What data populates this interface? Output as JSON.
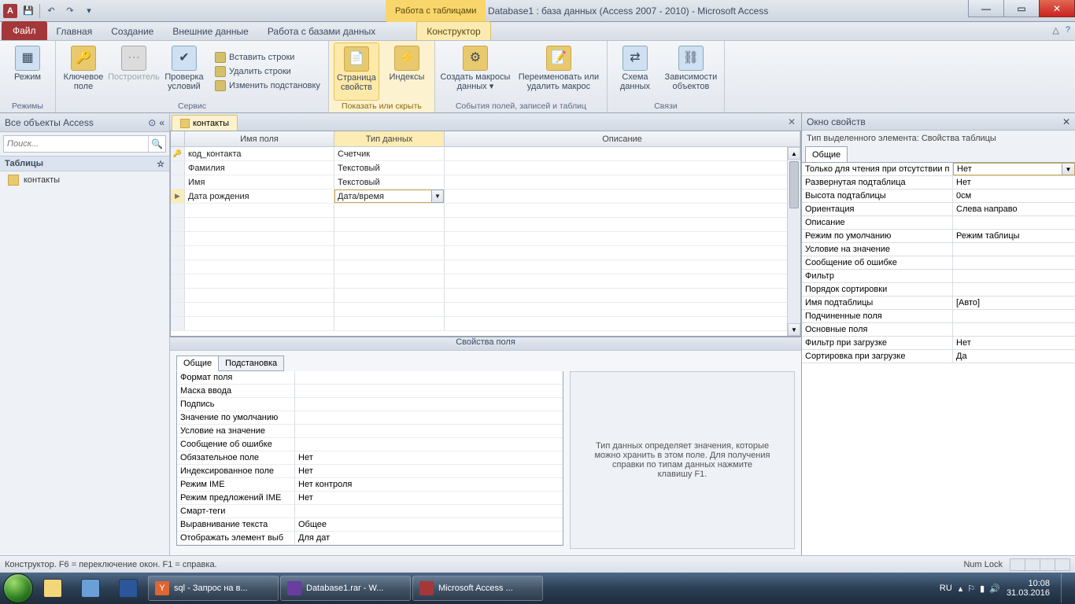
{
  "titlebar": {
    "context_tab": "Работа с таблицами",
    "title": "Database1 : база данных (Access 2007 - 2010)  -  Microsoft Access"
  },
  "ribbon_tabs": {
    "file": "Файл",
    "home": "Главная",
    "create": "Создание",
    "external": "Внешние данные",
    "dbtools": "Работа с базами данных",
    "design": "Конструктор"
  },
  "ribbon": {
    "g_views": {
      "label": "Режимы",
      "view": "Режим"
    },
    "g_tools": {
      "label": "Сервис",
      "primary_key": "Ключевое поле",
      "builder": "Построитель",
      "validation": "Проверка условий",
      "insert_rows": "Вставить строки",
      "delete_rows": "Удалить строки",
      "modify_lookup": "Изменить подстановку"
    },
    "g_showhide": {
      "label": "Показать или скрыть",
      "prop_sheet": "Страница свойств",
      "indexes": "Индексы"
    },
    "g_events": {
      "label": "События полей, записей и таблиц",
      "create_macros": "Создать макросы данных ▾",
      "rename_delete": "Переименовать или удалить макрос"
    },
    "g_rel": {
      "label": "Связи",
      "relationships": "Схема данных",
      "dependencies": "Зависимости объектов"
    }
  },
  "nav": {
    "header": "Все объекты Access",
    "search_placeholder": "Поиск...",
    "group_tables": "Таблицы",
    "item_contacts": "контакты"
  },
  "doc": {
    "tab": "контакты"
  },
  "grid": {
    "headers": {
      "name": "Имя поля",
      "type": "Тип данных",
      "desc": "Описание"
    },
    "rows": [
      {
        "key": true,
        "name": "код_контакта",
        "type": "Счетчик"
      },
      {
        "key": false,
        "name": "Фамилия",
        "type": "Текстовый"
      },
      {
        "key": false,
        "name": "Имя",
        "type": "Текстовый"
      },
      {
        "key": false,
        "name": "Дата рождения",
        "type": "Дата/время",
        "editing": true
      }
    ]
  },
  "field_props": {
    "header": "Свойства поля",
    "tab_general": "Общие",
    "tab_lookup": "Подстановка",
    "rows": [
      {
        "l": "Формат поля",
        "r": ""
      },
      {
        "l": "Маска ввода",
        "r": ""
      },
      {
        "l": "Подпись",
        "r": ""
      },
      {
        "l": "Значение по умолчанию",
        "r": ""
      },
      {
        "l": "Условие на значение",
        "r": ""
      },
      {
        "l": "Сообщение об ошибке",
        "r": ""
      },
      {
        "l": "Обязательное поле",
        "r": "Нет"
      },
      {
        "l": "Индексированное поле",
        "r": "Нет"
      },
      {
        "l": "Режим IME",
        "r": "Нет контроля"
      },
      {
        "l": "Режим предложений IME",
        "r": "Нет"
      },
      {
        "l": "Смарт-теги",
        "r": ""
      },
      {
        "l": "Выравнивание текста",
        "r": "Общее"
      },
      {
        "l": "Отображать элемент выб",
        "r": "Для дат"
      }
    ],
    "help": "Тип данных определяет значения, которые можно хранить в этом поле. Для получения справки по типам данных нажмите клавишу F1."
  },
  "prop_sheet": {
    "title": "Окно свойств",
    "subtitle": "Тип выделенного элемента:  Свойства таблицы",
    "tab": "Общие",
    "rows": [
      {
        "l": "Только для чтения при отсутствии п",
        "r": "Нет",
        "dd": true,
        "sel": true
      },
      {
        "l": "Развернутая подтаблица",
        "r": "Нет"
      },
      {
        "l": "Высота подтаблицы",
        "r": "0см"
      },
      {
        "l": "Ориентация",
        "r": "Слева направо"
      },
      {
        "l": "Описание",
        "r": ""
      },
      {
        "l": "Режим по умолчанию",
        "r": "Режим таблицы"
      },
      {
        "l": "Условие на значение",
        "r": ""
      },
      {
        "l": "Сообщение об ошибке",
        "r": ""
      },
      {
        "l": "Фильтр",
        "r": ""
      },
      {
        "l": "Порядок сортировки",
        "r": ""
      },
      {
        "l": "Имя подтаблицы",
        "r": "[Авто]"
      },
      {
        "l": "Подчиненные поля",
        "r": ""
      },
      {
        "l": "Основные поля",
        "r": ""
      },
      {
        "l": "Фильтр при загрузке",
        "r": "Нет"
      },
      {
        "l": "Сортировка при загрузке",
        "r": "Да"
      }
    ]
  },
  "statusbar": {
    "left": "Конструктор.  F6 = переключение окон.  F1 = справка.",
    "numlock": "Num Lock"
  },
  "taskbar": {
    "tasks": [
      "sql - Запрос на в...",
      "Database1.rar - W...",
      "Microsoft Access ..."
    ],
    "lang": "RU",
    "time": "10:08",
    "date": "31.03.2016"
  }
}
